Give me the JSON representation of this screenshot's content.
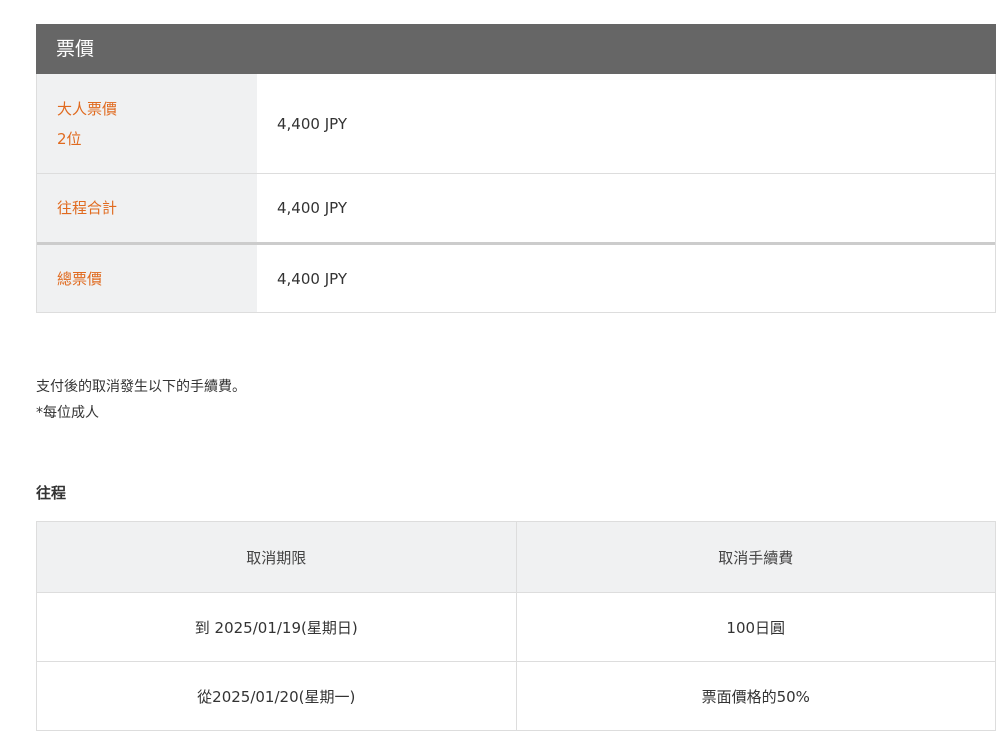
{
  "fare": {
    "title": "票價",
    "rows": [
      {
        "label": "大人票價",
        "sublabel": "2位",
        "value": "4,400 JPY"
      },
      {
        "label": "往程合計",
        "value": "4,400 JPY"
      },
      {
        "label": "總票價",
        "value": "4,400 JPY"
      }
    ]
  },
  "notice": {
    "line1": "支付後的取消發生以下的手續費。",
    "line2": "*每位成人"
  },
  "cancellation": {
    "section_title": "往程",
    "headers": [
      "取消期限",
      "取消手續費"
    ],
    "rows": [
      [
        "到 2025/01/19(星期日)",
        "100日圓"
      ],
      [
        "從2025/01/20(星期一)",
        "票面價格的50%"
      ]
    ]
  },
  "colors": {
    "header_bg": "#666666",
    "label_text": "#e06a1f",
    "label_bg": "#f0f1f2"
  }
}
